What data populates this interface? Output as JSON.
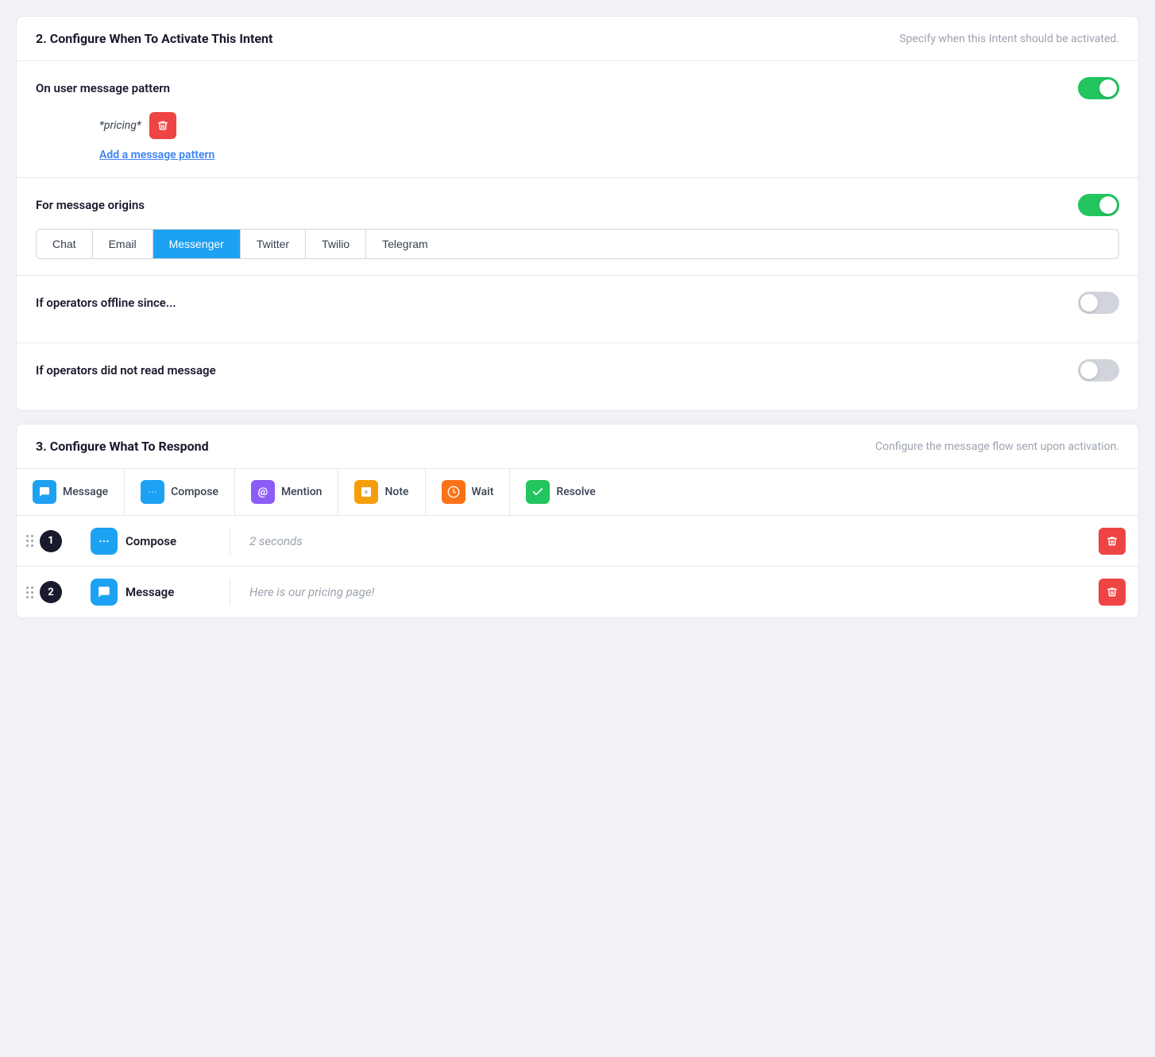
{
  "section2": {
    "title": "2. Configure When To Activate This Intent",
    "subtitle": "Specify when this Intent should be activated.",
    "message_pattern": {
      "label": "On user message pattern",
      "toggle": "on",
      "pattern_value": "*pricing*",
      "add_link_label": "Add a message pattern"
    },
    "message_origins": {
      "label": "For message origins",
      "toggle": "on",
      "buttons": [
        "Chat",
        "Email",
        "Messenger",
        "Twitter",
        "Twilio",
        "Telegram"
      ],
      "active_button": "Messenger"
    },
    "offline_since": {
      "label": "If operators offline since...",
      "toggle": "off"
    },
    "not_read": {
      "label": "If operators did not read message",
      "toggle": "off"
    }
  },
  "section3": {
    "title": "3. Configure What To Respond",
    "subtitle": "Configure the message flow sent upon activation.",
    "actions": [
      {
        "label": "Message",
        "icon": "message-icon",
        "icon_class": "icon-message"
      },
      {
        "label": "Compose",
        "icon": "compose-icon",
        "icon_class": "icon-compose"
      },
      {
        "label": "Mention",
        "icon": "mention-icon",
        "icon_class": "icon-mention"
      },
      {
        "label": "Note",
        "icon": "note-icon",
        "icon_class": "icon-note"
      },
      {
        "label": "Wait",
        "icon": "wait-icon",
        "icon_class": "icon-wait"
      },
      {
        "label": "Resolve",
        "icon": "resolve-icon",
        "icon_class": "icon-resolve"
      }
    ],
    "flow_items": [
      {
        "number": 1,
        "type": "Compose",
        "icon_class": "icon-compose",
        "content": "2 seconds"
      },
      {
        "number": 2,
        "type": "Message",
        "icon_class": "icon-message",
        "content": "Here is our pricing page!"
      }
    ]
  },
  "icons": {
    "delete": "🗑",
    "message_symbol": "💬",
    "compose_symbol": "···",
    "mention_symbol": "@",
    "note_symbol": "🔖",
    "wait_symbol": "⏱",
    "resolve_symbol": "✓"
  }
}
